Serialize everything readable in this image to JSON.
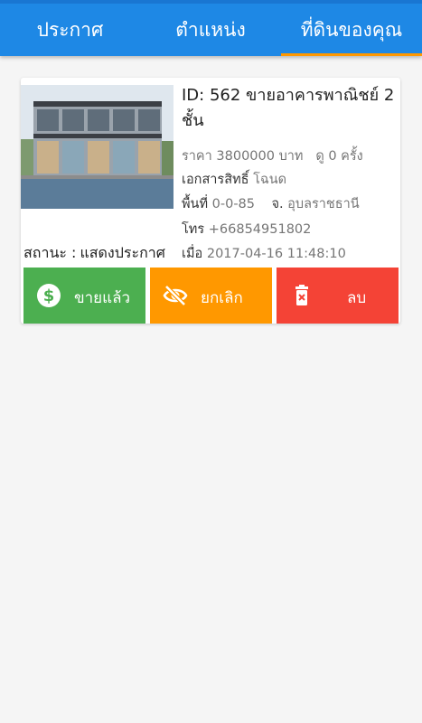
{
  "tabs": [
    {
      "label": "ประกาศ",
      "active": false
    },
    {
      "label": "ตำแหน่ง",
      "active": false
    },
    {
      "label": "ที่ดินของคุณ",
      "active": true
    }
  ],
  "colors": {
    "appbar": "#1e88e5",
    "indicator": "#ff9800",
    "sold": "#4caf50",
    "cancel": "#ff9800",
    "delete": "#f44336"
  },
  "listing": {
    "title": "ID: 562 ขายอาคารพาณิชย์ 2 ชั้น",
    "price_label": "ราคา",
    "price": "3800000 บาท",
    "views_label": "ดู",
    "views": "0 ครั้ง",
    "deed_label": "เอกสารสิทธิ์",
    "deed": "โฉนด",
    "area_label": "พื้นที่",
    "area": "0-0-85",
    "province_label": "จ.",
    "province": "อุบลราชธานี",
    "phone_label": "โทร",
    "phone": "+66854951802",
    "date_label": "เมื่อ",
    "date": "2017-04-16 11:48:10",
    "status_label": "สถานะ :",
    "status": "แสดงประกาศ",
    "image_icon": "building-photo"
  },
  "actions": {
    "sold": {
      "label": "ขายแล้ว",
      "icon": "dollar-circle-icon"
    },
    "cancel": {
      "label": "ยกเลิก",
      "icon": "eye-off-icon"
    },
    "delete": {
      "label": "ลบ",
      "icon": "trash-icon"
    }
  }
}
